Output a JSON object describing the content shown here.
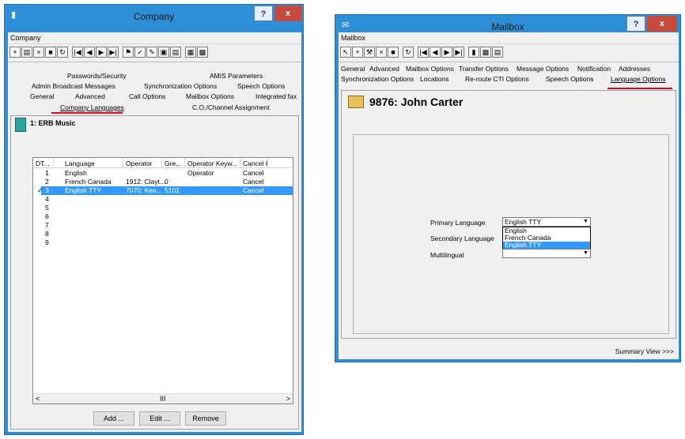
{
  "company": {
    "title": "Company",
    "menu": "Company",
    "record": "1: ERB Music",
    "tabs_row1": [
      "Passwords/Security",
      "AMIS Parameters"
    ],
    "tabs_row2": [
      "Admin Broadcast Messages",
      "Synchronization Options",
      "Speech Options"
    ],
    "tabs_row3": [
      "General",
      "Advanced",
      "Call Options",
      "Mailbox Options",
      "Integrated fax"
    ],
    "tabs_row4": [
      "Company Languages",
      "C.O./Channel Assignment"
    ],
    "columns": [
      "DT...",
      "Language",
      "Operator",
      "Gre...",
      "Operator Keyw...",
      "Cancel K"
    ],
    "rows": [
      {
        "dt": "1",
        "lang": "English",
        "op": "",
        "gre": "",
        "kw": "Operator",
        "cancel": "Cancel"
      },
      {
        "dt": "2",
        "lang": "French Canada",
        "op": "1912: Clayt...",
        "gre": "0",
        "kw": "",
        "cancel": "Cancel"
      },
      {
        "dt": "3",
        "lang": "English TTY",
        "op": "7070: Kee...",
        "gre": "5101",
        "kw": "",
        "cancel": "Cancel"
      },
      {
        "dt": "4",
        "lang": "",
        "op": "",
        "gre": "",
        "kw": "",
        "cancel": ""
      },
      {
        "dt": "5",
        "lang": "",
        "op": "",
        "gre": "",
        "kw": "",
        "cancel": ""
      },
      {
        "dt": "6",
        "lang": "",
        "op": "",
        "gre": "",
        "kw": "",
        "cancel": ""
      },
      {
        "dt": "7",
        "lang": "",
        "op": "",
        "gre": "",
        "kw": "",
        "cancel": ""
      },
      {
        "dt": "8",
        "lang": "",
        "op": "",
        "gre": "",
        "kw": "",
        "cancel": ""
      },
      {
        "dt": "9",
        "lang": "",
        "op": "",
        "gre": "",
        "kw": "",
        "cancel": ""
      }
    ],
    "buttons": {
      "add": "Add ...",
      "edit": "Edit ...",
      "remove": "Remove"
    },
    "scroll_mid": "III"
  },
  "mailbox": {
    "title": "Mailbox",
    "menu": "Mailbox",
    "record": "9876: John Carter",
    "tabs_row1": [
      "General",
      "Advanced",
      "Mailbox Options",
      "Transfer Options",
      "Message Options",
      "Notification",
      "Addresses"
    ],
    "tabs_row2": [
      "Synchronization Options",
      "Locations",
      "Re-route CTI Options",
      "Speech Options",
      "Language Options"
    ],
    "primary_label": "Primary Language",
    "primary_value": "English TTY",
    "secondary_label": "Secondary Language",
    "multilingual_label": "Multilingual",
    "dropdown_options": [
      "English",
      "French Canada",
      "English TTY"
    ],
    "summary": "Summary View >>>"
  },
  "titlebar": {
    "help": "?",
    "close": "x"
  },
  "colors": {
    "titlebar": "#2c8fd8",
    "selection": "#3399ff",
    "highlight": "#e0001b"
  }
}
